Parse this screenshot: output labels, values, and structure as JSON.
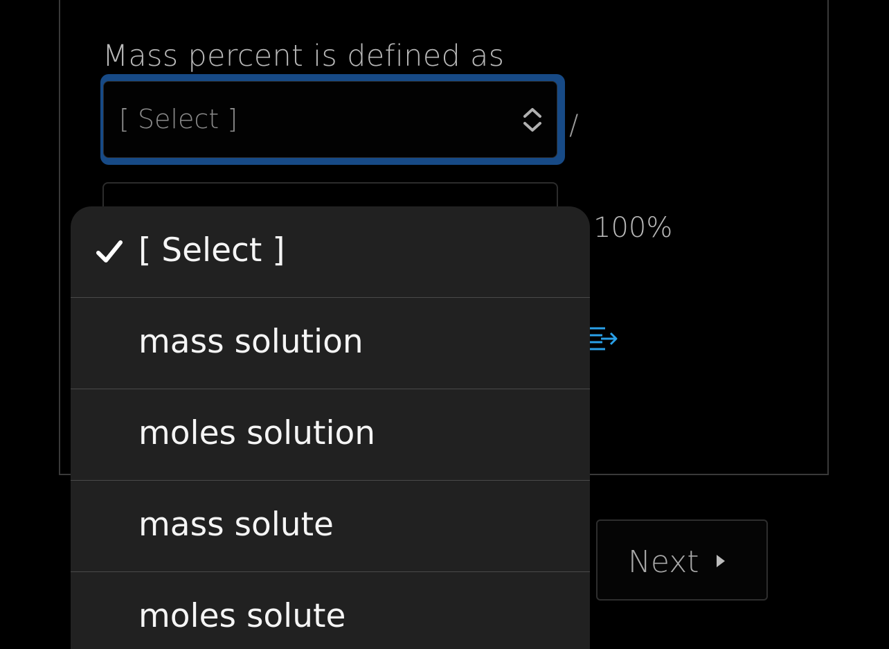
{
  "question": {
    "prompt": "Mass percent is defined as",
    "numerator_select_value": "[ Select ]",
    "slash": "/",
    "times_percent": "100%"
  },
  "navigation": {
    "next_label": "Next"
  },
  "dropdown": {
    "selected_index": 0,
    "options": [
      {
        "label": "[ Select ]",
        "selected": true
      },
      {
        "label": "mass solution",
        "selected": false
      },
      {
        "label": "moles solution",
        "selected": false
      },
      {
        "label": "mass solute",
        "selected": false
      },
      {
        "label": "moles solute",
        "selected": false
      }
    ]
  },
  "icons": {
    "select_chevrons": "chevron-up-down-icon",
    "embed": "embed-icon",
    "next_arrow": "triangle-right-icon",
    "check": "checkmark-icon"
  },
  "colors": {
    "background": "#000000",
    "focus_ring": "#174a86",
    "dropdown_bg": "#212121",
    "accent_icon": "#2aa0e8"
  }
}
